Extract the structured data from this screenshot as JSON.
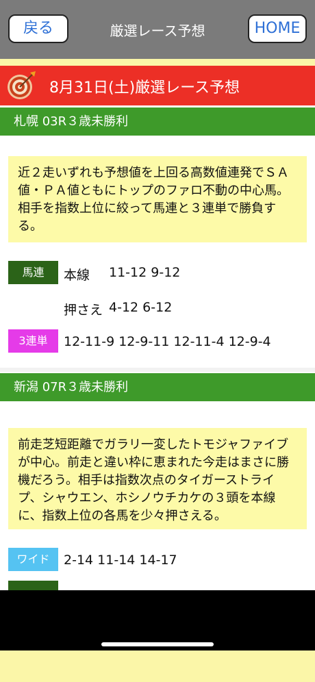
{
  "nav": {
    "back_label": "戻る",
    "title": "厳選レース予想",
    "home_label": "HOME"
  },
  "header": {
    "title": "8月31日(土)厳選レース予想"
  },
  "races": [
    {
      "heading": "札幌 03R３歳未勝利",
      "comment": "近２走いずれも予想値を上回る高数値連発でＳＡ値・ＰＡ値ともにトップのファロ不動の中心馬。相手を指数上位に絞って馬連と３連単で勝負する。",
      "bets": [
        {
          "type": "馬連",
          "color": "#2b6318",
          "lines": [
            {
              "label": "本線",
              "combos": "11-12 9-12"
            },
            {
              "label": "押さえ",
              "combos": "4-12 6-12"
            }
          ]
        },
        {
          "type": "3連単",
          "color": "#e53be8",
          "lines": [
            {
              "label": "",
              "combos": "12-11-9 12-9-11 12-11-4 12-9-4"
            }
          ]
        }
      ]
    },
    {
      "heading": "新潟 07R３歳未勝利",
      "comment": "前走芝短距離でガラリ一変したトモジャファイブが中心。前走と違い枠に恵まれた今走はまさに勝機だろう。相手は指数次点のタイガーストライプ、シャウエン、ホシノウチカケの３頭を本線に、指数上位の各馬を少々押さえる。",
      "bets": [
        {
          "type": "ワイド",
          "color": "#55c3f2",
          "lines": [
            {
              "label": "",
              "combos": "2-14 11-14 14-17"
            }
          ]
        }
      ]
    }
  ],
  "colors": {
    "nav": "#7b7b7b",
    "title_bar": "#ec2f26",
    "race_header": "#3e9a2a",
    "comment_bg": "#fdfaa8"
  },
  "icons": {
    "header": "target-icon"
  }
}
